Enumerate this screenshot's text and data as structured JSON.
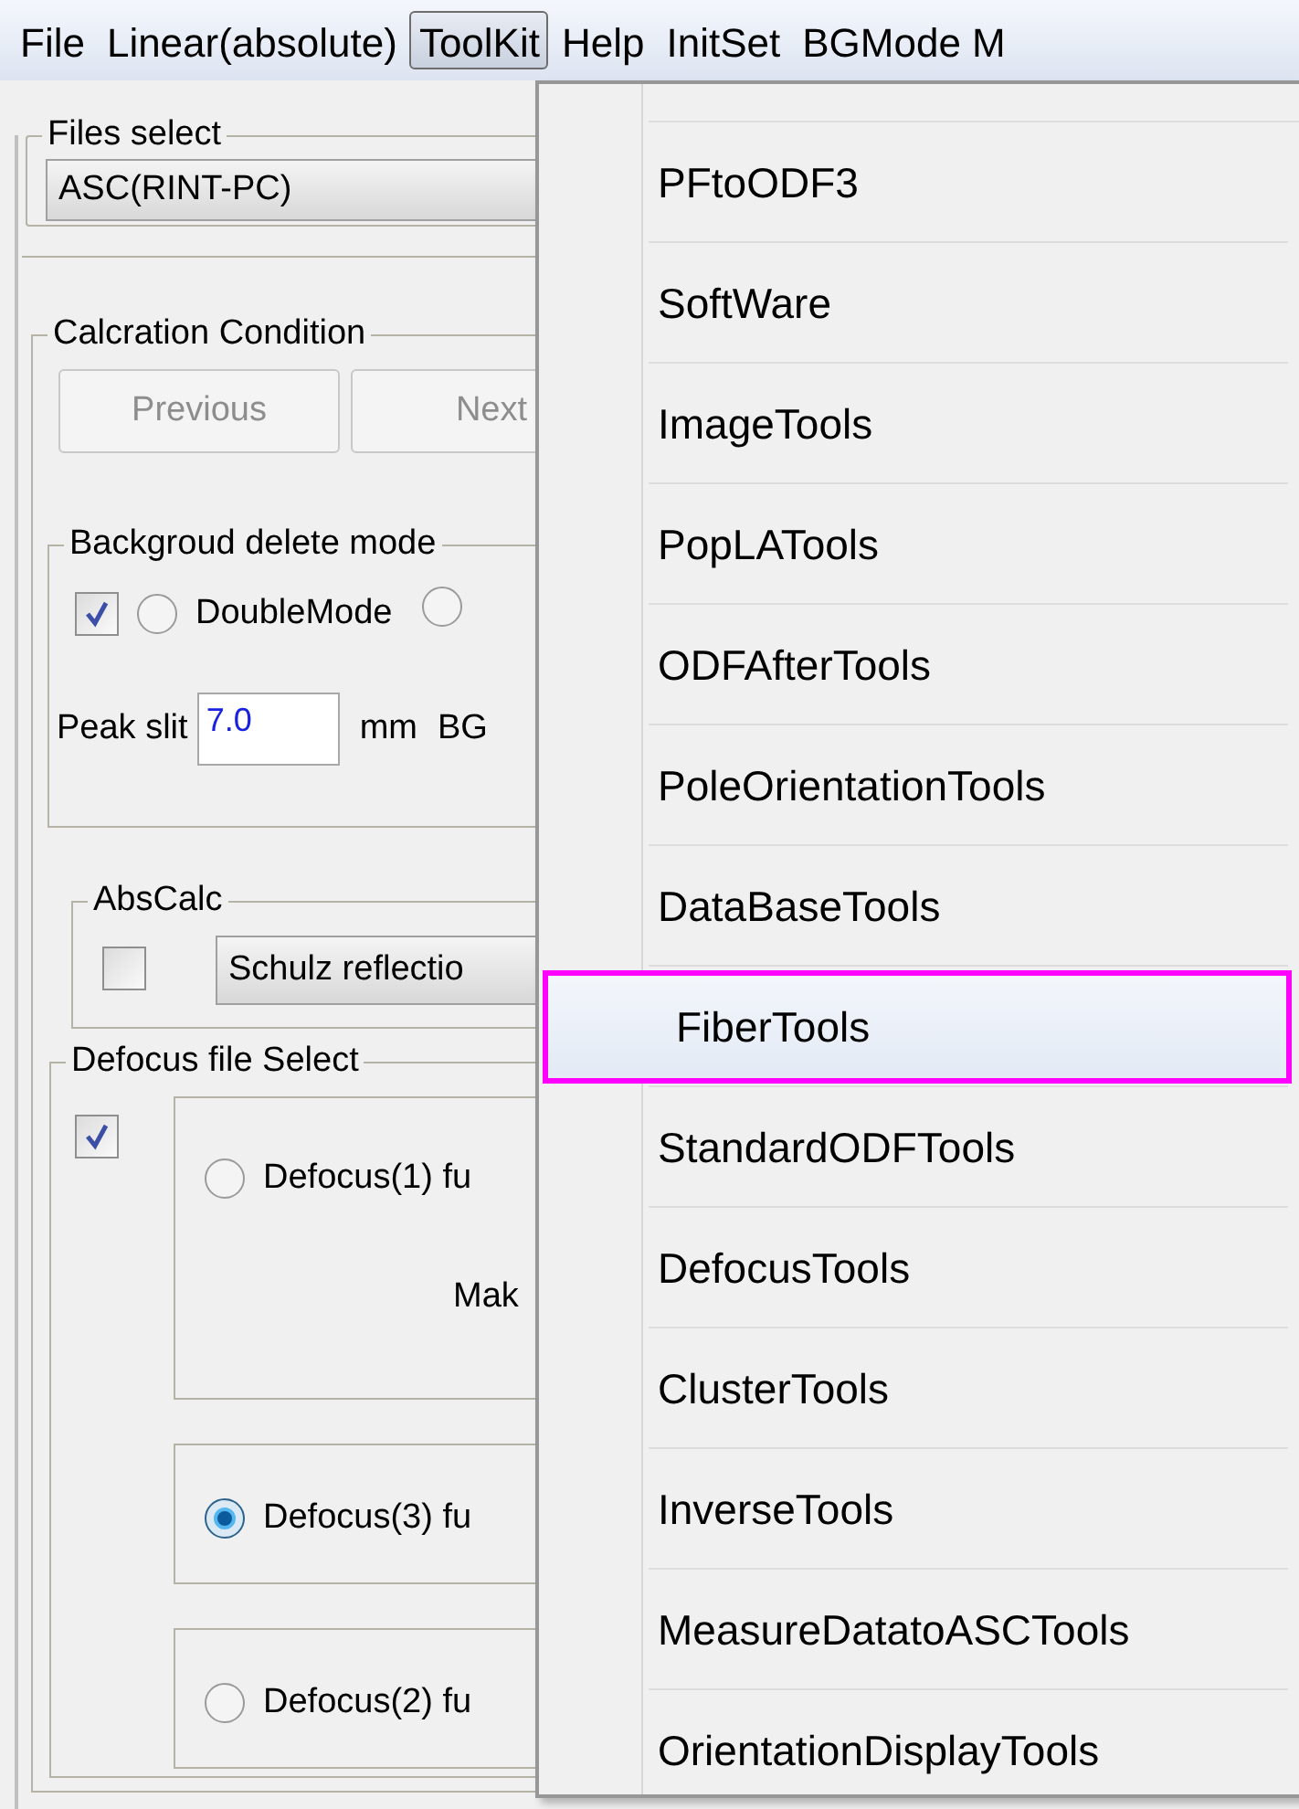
{
  "menubar": [
    {
      "label": "File",
      "selected": false
    },
    {
      "label": "Linear(absolute)",
      "selected": false
    },
    {
      "label": "ToolKit",
      "selected": true
    },
    {
      "label": "Help",
      "selected": false
    },
    {
      "label": "InitSet",
      "selected": false
    },
    {
      "label": "BGMode M",
      "selected": false
    }
  ],
  "files_select": {
    "title": "Files select",
    "value": "ASC(RINT-PC)"
  },
  "calc_condition": {
    "title": "Calcration Condition",
    "buttons": [
      {
        "label": "Previous",
        "disabled": true
      },
      {
        "label": "Next",
        "disabled": true
      }
    ],
    "bg_delete": {
      "title": "Backgroud delete mode",
      "checked": true,
      "radio_label": "DoubleMode",
      "radio_selected": false,
      "radio2_selected": false,
      "peak_label": "Peak slit",
      "peak_value": "7.0",
      "unit": "mm",
      "bg_label": "BG"
    },
    "abscalc": {
      "title": "AbsCalc",
      "checked": false,
      "value": "Schulz reflectio"
    },
    "defocus": {
      "title": "Defocus file Select",
      "checked": true,
      "options": [
        {
          "label": "Defocus(1) fu",
          "selected": false,
          "note": "Mak"
        },
        {
          "label": "Defocus(3) fu",
          "selected": true
        },
        {
          "label": "Defocus(2) fu",
          "selected": false
        }
      ]
    }
  },
  "toolkit_menu": [
    {
      "label": "PFtoODF3",
      "selected": false
    },
    {
      "label": "SoftWare",
      "selected": false
    },
    {
      "label": "ImageTools",
      "selected": false
    },
    {
      "label": "PopLATools",
      "selected": false
    },
    {
      "label": "ODFAfterTools",
      "selected": false
    },
    {
      "label": "PoleOrientationTools",
      "selected": false
    },
    {
      "label": "DataBaseTools",
      "selected": false
    },
    {
      "label": "FiberTools",
      "selected": true
    },
    {
      "label": "StandardODFTools",
      "selected": false
    },
    {
      "label": "DefocusTools",
      "selected": false
    },
    {
      "label": "ClusterTools",
      "selected": false
    },
    {
      "label": "InverseTools",
      "selected": false
    },
    {
      "label": "MeasureDatatoASCTools",
      "selected": false
    },
    {
      "label": "OrientationDisplayTools",
      "selected": false
    }
  ]
}
